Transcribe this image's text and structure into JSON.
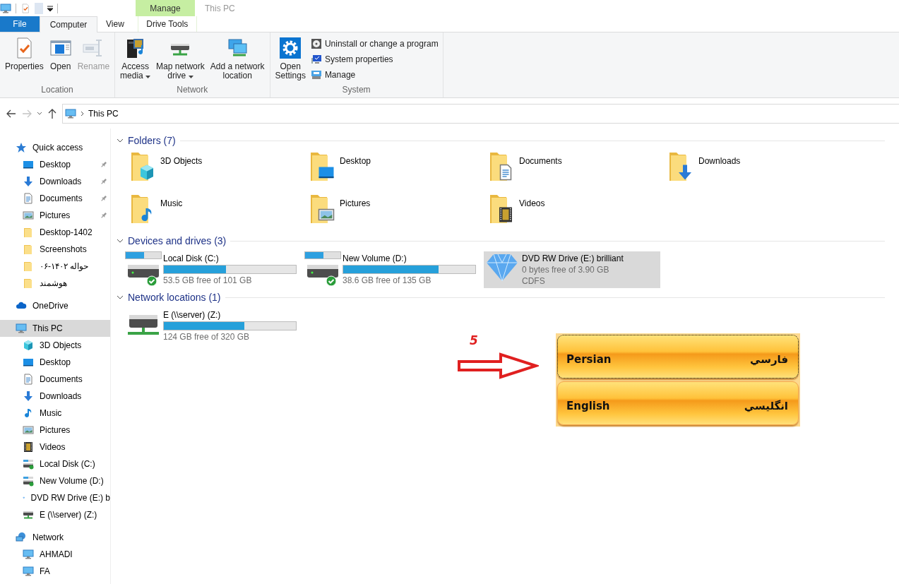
{
  "window": {
    "title": "This PC"
  },
  "ribbon": {
    "context_header": "Manage",
    "tabs": [
      {
        "label": "File",
        "kind": "file",
        "selected": false
      },
      {
        "label": "Computer",
        "kind": "normal",
        "selected": true
      },
      {
        "label": "View",
        "kind": "normal",
        "selected": false
      },
      {
        "label": "Drive Tools",
        "kind": "context",
        "selected": false
      }
    ],
    "groups": [
      {
        "label": "Location",
        "commands": [
          {
            "kind": "large",
            "label": "Properties",
            "disabled": false,
            "dropdown": false
          },
          {
            "kind": "large",
            "label": "Open",
            "disabled": false,
            "dropdown": false
          },
          {
            "kind": "large",
            "label": "Rename",
            "disabled": true,
            "dropdown": false
          }
        ]
      },
      {
        "label": "Network",
        "commands": [
          {
            "kind": "large",
            "label": "Access\nmedia",
            "disabled": false,
            "dropdown": true
          },
          {
            "kind": "large",
            "label": "Map network\ndrive",
            "disabled": false,
            "dropdown": true
          },
          {
            "kind": "large",
            "label": "Add a network\nlocation",
            "disabled": false,
            "dropdown": false
          }
        ]
      },
      {
        "label": "System",
        "commands": [
          {
            "kind": "large",
            "label": "Open\nSettings",
            "disabled": false,
            "dropdown": false
          },
          {
            "kind": "small",
            "label": "Uninstall or change a program",
            "disabled": false
          },
          {
            "kind": "small",
            "label": "System properties",
            "disabled": false
          },
          {
            "kind": "small",
            "label": "Manage",
            "disabled": false
          }
        ]
      }
    ]
  },
  "navigation": {
    "back": {
      "disabled": false
    },
    "forward": {
      "disabled": true
    },
    "up": {
      "disabled": false
    }
  },
  "address_bar": {
    "path": "This PC"
  },
  "sidebar": {
    "items": [
      {
        "label": "Quick access",
        "kind": "star",
        "selected": false,
        "children": [
          {
            "label": "Desktop",
            "kind": "desktop",
            "selected": false,
            "pinned": true
          },
          {
            "label": "Downloads",
            "kind": "downloads",
            "selected": false,
            "pinned": true
          },
          {
            "label": "Documents",
            "kind": "documents",
            "selected": false,
            "pinned": true
          },
          {
            "label": "Pictures",
            "kind": "pictures",
            "selected": false,
            "pinned": true
          },
          {
            "label": "Desktop-1402",
            "kind": "folder",
            "selected": false,
            "pinned": false
          },
          {
            "label": "Screenshots",
            "kind": "folder",
            "selected": false,
            "pinned": false
          },
          {
            "label": "حواله ۱۴۰۲-۰۶",
            "kind": "folder",
            "selected": false,
            "pinned": false
          },
          {
            "label": "هوشمند",
            "kind": "folder",
            "selected": false,
            "pinned": false
          }
        ]
      },
      {
        "label": "OneDrive",
        "kind": "cloud",
        "selected": false
      },
      {
        "label": "This PC",
        "kind": "pc",
        "selected": true,
        "children": [
          {
            "label": "3D Objects",
            "kind": "cube",
            "selected": false,
            "pinned": false
          },
          {
            "label": "Desktop",
            "kind": "desktop",
            "selected": false,
            "pinned": false
          },
          {
            "label": "Documents",
            "kind": "documents",
            "selected": false,
            "pinned": false
          },
          {
            "label": "Downloads",
            "kind": "downloads",
            "selected": false,
            "pinned": false
          },
          {
            "label": "Music",
            "kind": "music",
            "selected": false,
            "pinned": false
          },
          {
            "label": "Pictures",
            "kind": "pictures",
            "selected": false,
            "pinned": false
          },
          {
            "label": "Videos",
            "kind": "video",
            "selected": false,
            "pinned": false
          },
          {
            "label": "Local Disk (C:)",
            "kind": "hdd",
            "selected": false,
            "pinned": false
          },
          {
            "label": "New Volume (D:)",
            "kind": "hdd",
            "selected": false,
            "pinned": false
          },
          {
            "label": "DVD RW Drive (E:) b",
            "kind": "dvd",
            "selected": false,
            "pinned": false
          },
          {
            "label": "E (\\\\server) (Z:)",
            "kind": "netdrive",
            "selected": false,
            "pinned": false
          }
        ]
      },
      {
        "label": "Network",
        "kind": "network",
        "selected": false,
        "children": [
          {
            "label": "AHMADI",
            "kind": "pc",
            "selected": false,
            "pinned": false
          },
          {
            "label": "FA",
            "kind": "pc",
            "selected": false,
            "pinned": false
          }
        ]
      }
    ]
  },
  "content": {
    "groups": [
      {
        "title": "Folders (7)",
        "kind": "folders",
        "expanded": true,
        "items": [
          {
            "label": "3D Objects",
            "kind": "cube"
          },
          {
            "label": "Desktop",
            "kind": "desktop"
          },
          {
            "label": "Documents",
            "kind": "documents"
          },
          {
            "label": "Downloads",
            "kind": "downloads"
          },
          {
            "label": "Music",
            "kind": "music"
          },
          {
            "label": "Pictures",
            "kind": "pictures"
          },
          {
            "label": "Videos",
            "kind": "video"
          }
        ]
      },
      {
        "title": "Devices and drives (3)",
        "kind": "drives",
        "expanded": true,
        "items": [
          {
            "kind": "disk",
            "label": "Local Disk (C:)",
            "level": 0.47,
            "detail": "53.5 GB free of 101 GB",
            "verified": true,
            "selected": false
          },
          {
            "kind": "disk",
            "label": "New Volume (D:)",
            "level": 0.72,
            "detail": "38.6 GB free of 135 GB",
            "verified": true,
            "selected": false
          },
          {
            "kind": "optical",
            "label": "DVD RW Drive (E:) brilliant",
            "detail": "0 bytes free of 3.90 GB",
            "filesystem": "CDFS",
            "verified": false,
            "selected": true
          }
        ]
      },
      {
        "title": "Network locations (1)",
        "kind": "drives",
        "expanded": true,
        "items": [
          {
            "kind": "network",
            "label": "E (\\\\server) (Z:)",
            "level": 0.61,
            "detail": "124 GB free of 320 GB",
            "verified": false,
            "selected": false
          }
        ]
      }
    ]
  },
  "annotation": {
    "number": "5"
  },
  "language_menu": {
    "options": [
      {
        "label": "Persian",
        "native": "فارسي",
        "focused": true
      },
      {
        "label": "English",
        "native": "انگليسي",
        "focused": false
      }
    ]
  }
}
